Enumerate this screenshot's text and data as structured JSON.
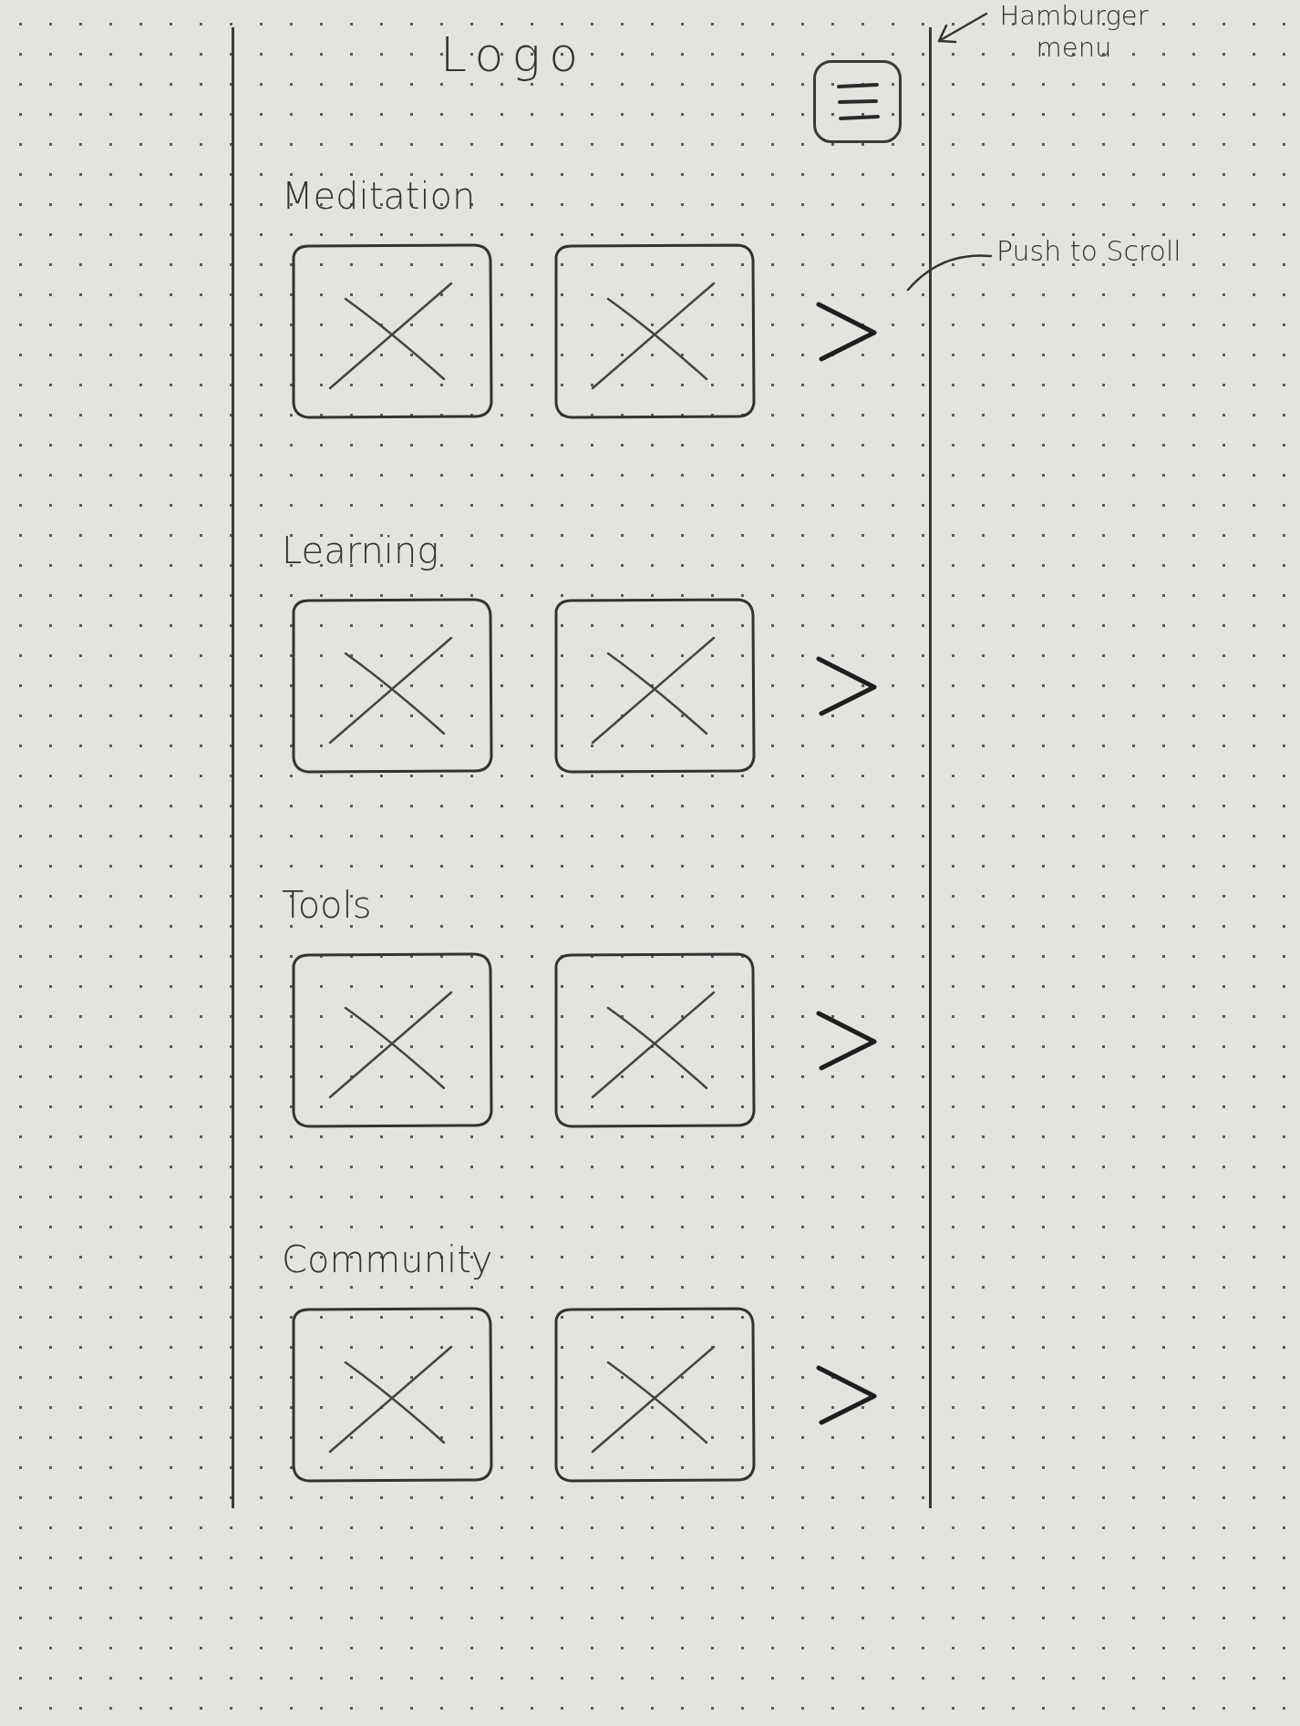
{
  "header": {
    "logo": "Logo"
  },
  "sections": [
    {
      "title": "Meditation",
      "cards": [
        {
          "kind": "image_placeholder"
        },
        {
          "kind": "image_placeholder"
        }
      ]
    },
    {
      "title": "Learning",
      "cards": [
        {
          "kind": "image_placeholder"
        },
        {
          "kind": "image_placeholder"
        }
      ]
    },
    {
      "title": "Tools",
      "cards": [
        {
          "kind": "image_placeholder"
        },
        {
          "kind": "image_placeholder"
        }
      ]
    },
    {
      "title": "Community",
      "cards": [
        {
          "kind": "image_placeholder"
        },
        {
          "kind": "image_placeholder"
        }
      ]
    }
  ],
  "callouts": [
    {
      "kind": "menu",
      "text": "Hamburger menu"
    },
    {
      "kind": "scroll",
      "text": "Push to Scroll"
    }
  ]
}
